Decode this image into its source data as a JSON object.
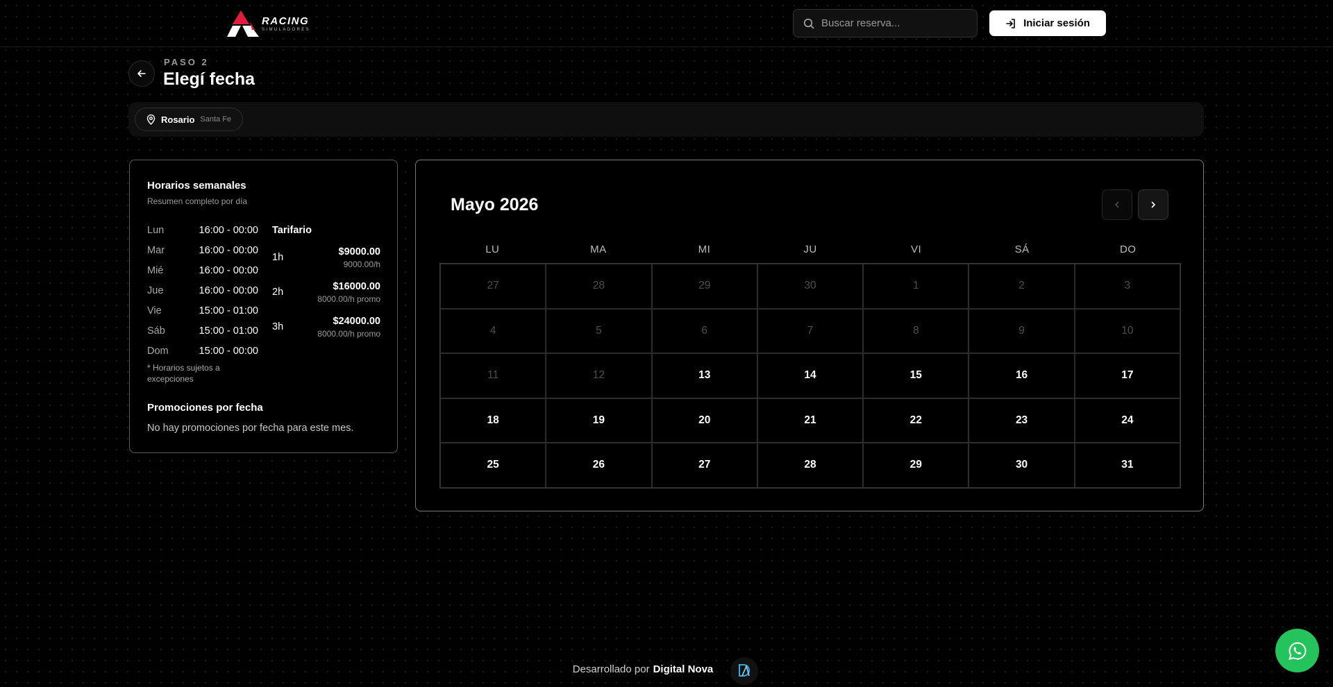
{
  "brand": {
    "name": "RACING",
    "tagline": "SIMULADORES",
    "accent": "#e11d3c"
  },
  "search": {
    "placeholder": "Buscar reserva..."
  },
  "header": {
    "login_label": "Iniciar sesión"
  },
  "step": {
    "label": "PASO 2",
    "title": "Elegí fecha"
  },
  "location": {
    "city": "Rosario",
    "province": "Santa Fe"
  },
  "hours": {
    "title": "Horarios semanales",
    "subtitle": "Resumen completo por día",
    "rows": [
      {
        "day": "Lun",
        "time": "16:00 - 00:00"
      },
      {
        "day": "Mar",
        "time": "16:00 - 00:00"
      },
      {
        "day": "Mié",
        "time": "16:00 - 00:00"
      },
      {
        "day": "Jue",
        "time": "16:00 - 00:00"
      },
      {
        "day": "Vie",
        "time": "15:00 - 01:00"
      },
      {
        "day": "Sáb",
        "time": "15:00 - 01:00"
      },
      {
        "day": "Dom",
        "time": "15:00 - 00:00"
      }
    ],
    "note": "* Horarios sujetos a excepciones"
  },
  "tarifario": {
    "title": "Tarifario",
    "rows": [
      {
        "duration": "1h",
        "price": "$9000.00",
        "rate": "9000.00/h"
      },
      {
        "duration": "2h",
        "price": "$16000.00",
        "rate": "8000.00/h promo"
      },
      {
        "duration": "3h",
        "price": "$24000.00",
        "rate": "8000.00/h promo"
      }
    ]
  },
  "promos": {
    "title": "Promociones por fecha",
    "empty_text": "No hay promociones por fecha para este mes."
  },
  "calendar": {
    "month_label": "Mayo 2026",
    "weekdays": [
      "LU",
      "MA",
      "MI",
      "JU",
      "VI",
      "SÁ",
      "DO"
    ],
    "weeks": [
      [
        {
          "day": "27",
          "state": "muted"
        },
        {
          "day": "28",
          "state": "muted"
        },
        {
          "day": "29",
          "state": "muted"
        },
        {
          "day": "30",
          "state": "muted"
        },
        {
          "day": "1",
          "state": "muted"
        },
        {
          "day": "2",
          "state": "muted"
        },
        {
          "day": "3",
          "state": "muted"
        }
      ],
      [
        {
          "day": "4",
          "state": "muted"
        },
        {
          "day": "5",
          "state": "muted"
        },
        {
          "day": "6",
          "state": "muted"
        },
        {
          "day": "7",
          "state": "muted"
        },
        {
          "day": "8",
          "state": "muted"
        },
        {
          "day": "9",
          "state": "muted"
        },
        {
          "day": "10",
          "state": "muted"
        }
      ],
      [
        {
          "day": "11",
          "state": "muted"
        },
        {
          "day": "12",
          "state": "muted"
        },
        {
          "day": "13",
          "state": "active"
        },
        {
          "day": "14",
          "state": "active"
        },
        {
          "day": "15",
          "state": "active"
        },
        {
          "day": "16",
          "state": "active"
        },
        {
          "day": "17",
          "state": "active"
        }
      ],
      [
        {
          "day": "18",
          "state": "active"
        },
        {
          "day": "19",
          "state": "active"
        },
        {
          "day": "20",
          "state": "active"
        },
        {
          "day": "21",
          "state": "active"
        },
        {
          "day": "22",
          "state": "active"
        },
        {
          "day": "23",
          "state": "active"
        },
        {
          "day": "24",
          "state": "active"
        }
      ],
      [
        {
          "day": "25",
          "state": "active"
        },
        {
          "day": "26",
          "state": "active"
        },
        {
          "day": "27",
          "state": "active"
        },
        {
          "day": "28",
          "state": "active"
        },
        {
          "day": "29",
          "state": "active"
        },
        {
          "day": "30",
          "state": "active"
        },
        {
          "day": "31",
          "state": "active"
        }
      ]
    ]
  },
  "footer": {
    "prefix": "Desarrollado por",
    "company": "Digital Nova"
  },
  "icons": {
    "search": "search-icon",
    "login": "login-icon",
    "back": "arrow-left-icon",
    "location": "map-pin-icon",
    "prev": "chevron-left-icon",
    "next": "chevron-right-icon",
    "whatsapp": "whatsapp-icon"
  },
  "colors": {
    "whatsapp": "#25c35c",
    "background": "#000000"
  }
}
